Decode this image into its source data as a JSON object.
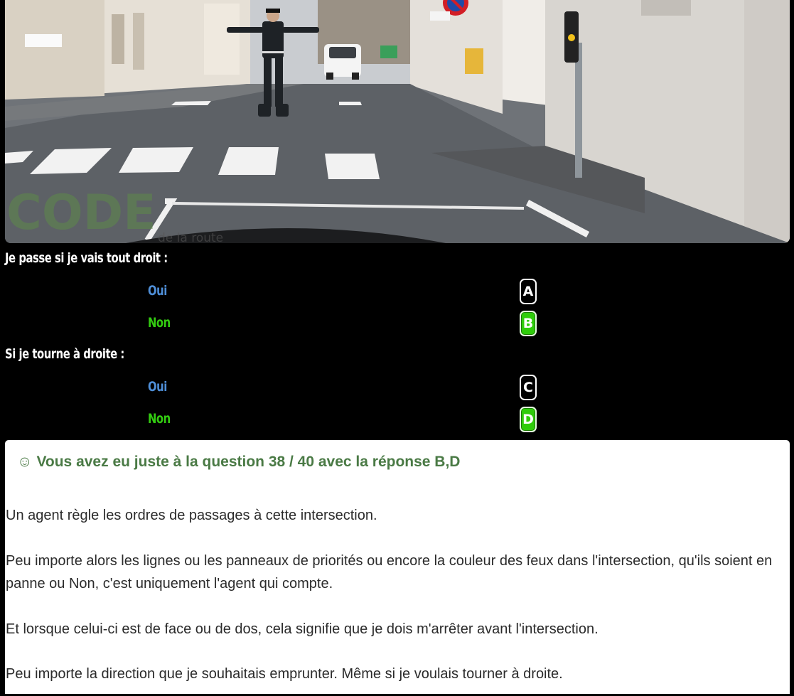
{
  "photo": {
    "watermark_text": "CODE",
    "watermark_sub": "de la route"
  },
  "questions": [
    {
      "text": "Je passe si je vais tout droit :",
      "answers": [
        {
          "label": "Oui",
          "key": "A",
          "selected": false
        },
        {
          "label": "Non",
          "key": "B",
          "selected": true
        }
      ]
    },
    {
      "text": "Si je tourne à droite :",
      "answers": [
        {
          "label": "Oui",
          "key": "C",
          "selected": false
        },
        {
          "label": "Non",
          "key": "D",
          "selected": true
        }
      ]
    }
  ],
  "feedback": {
    "icon": "☺",
    "title": "Vous avez eu juste à la question 38 / 40 avec la réponse B,D",
    "paragraphs": [
      "Un agent règle les ordres de passages à cette intersection.",
      "Peu importe alors les lignes ou les panneaux de priorités ou encore la couleur des feux dans l'intersection, qu'ils soient en panne ou Non, c'est uniquement l'agent qui compte.",
      "Et lorsque celui-ci est de face ou de dos, cela signifie que je dois m'arrêter avant l'intersection.",
      "Peu importe la direction que je souhaitais emprunter. Même si je voulais tourner à droite."
    ]
  },
  "colors": {
    "oui": "#4f8fd8",
    "non": "#33cc11",
    "selected_key": "#2fcc0b",
    "feedback_title": "#4a7a45"
  }
}
